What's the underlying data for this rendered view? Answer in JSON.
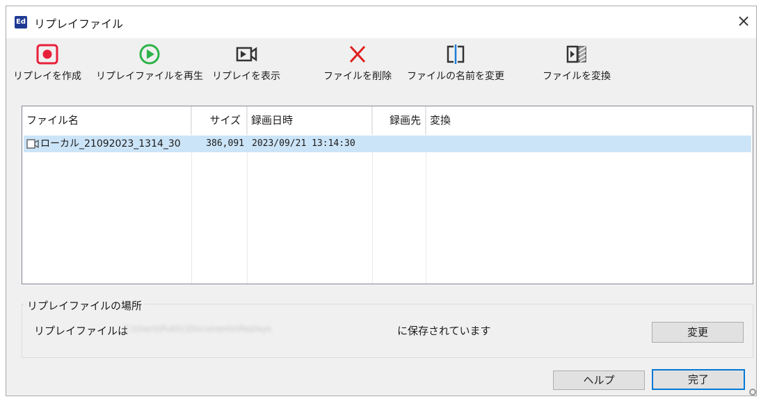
{
  "window": {
    "title": "リプレイファイル",
    "app_icon": "Ed",
    "close": "×"
  },
  "toolbar": {
    "create_label": "リプレイを作成",
    "play_label": "リプレイファイルを再生",
    "show_label": "リプレイを表示",
    "delete_label": "ファイルを削除",
    "rename_label": "ファイルの名前を変更",
    "convert_label": "ファイルを変換"
  },
  "list": {
    "columns": [
      "ファイル名",
      "サイズ",
      "録画日時",
      "録画先",
      "変換"
    ],
    "rows": [
      {
        "name": "ローカル_21092023_1314_30",
        "size": "386,091",
        "datetime": "2023/09/21 13:14:30",
        "destination": "",
        "conversion": ""
      }
    ]
  },
  "location": {
    "legend": "リプレイファイルの場所",
    "prefix": "リプレイファイルは",
    "path": "C:\\Users\\Public\\Documents\\Replays",
    "suffix": "に保存されています",
    "change_label": "変更"
  },
  "footer": {
    "help_label": "ヘルプ",
    "done_label": "完了"
  },
  "colors": {
    "record_red": "#e8213a",
    "play_green": "#2db34a",
    "delete_red": "#e02020",
    "selection": "#cce4f7",
    "primary_border": "#0078d7"
  }
}
